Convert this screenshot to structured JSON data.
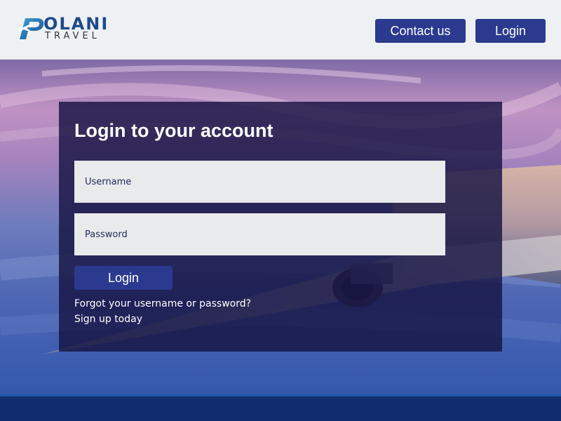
{
  "brand": {
    "name": "OLANI",
    "tagline": "TRAVEL",
    "colors": {
      "primary": "#2b3a8f",
      "logo": "#1d4a8a"
    }
  },
  "nav": {
    "contact_label": "Contact us",
    "login_label": "Login"
  },
  "login_form": {
    "title": "Login to your account",
    "username_placeholder": "Username",
    "password_placeholder": "Password",
    "submit_label": "Login",
    "forgot_link": "Forgot your username or password?",
    "signup_link": "Sign up today"
  },
  "icons": {
    "logo_mark": "plane-p-logo-icon"
  }
}
